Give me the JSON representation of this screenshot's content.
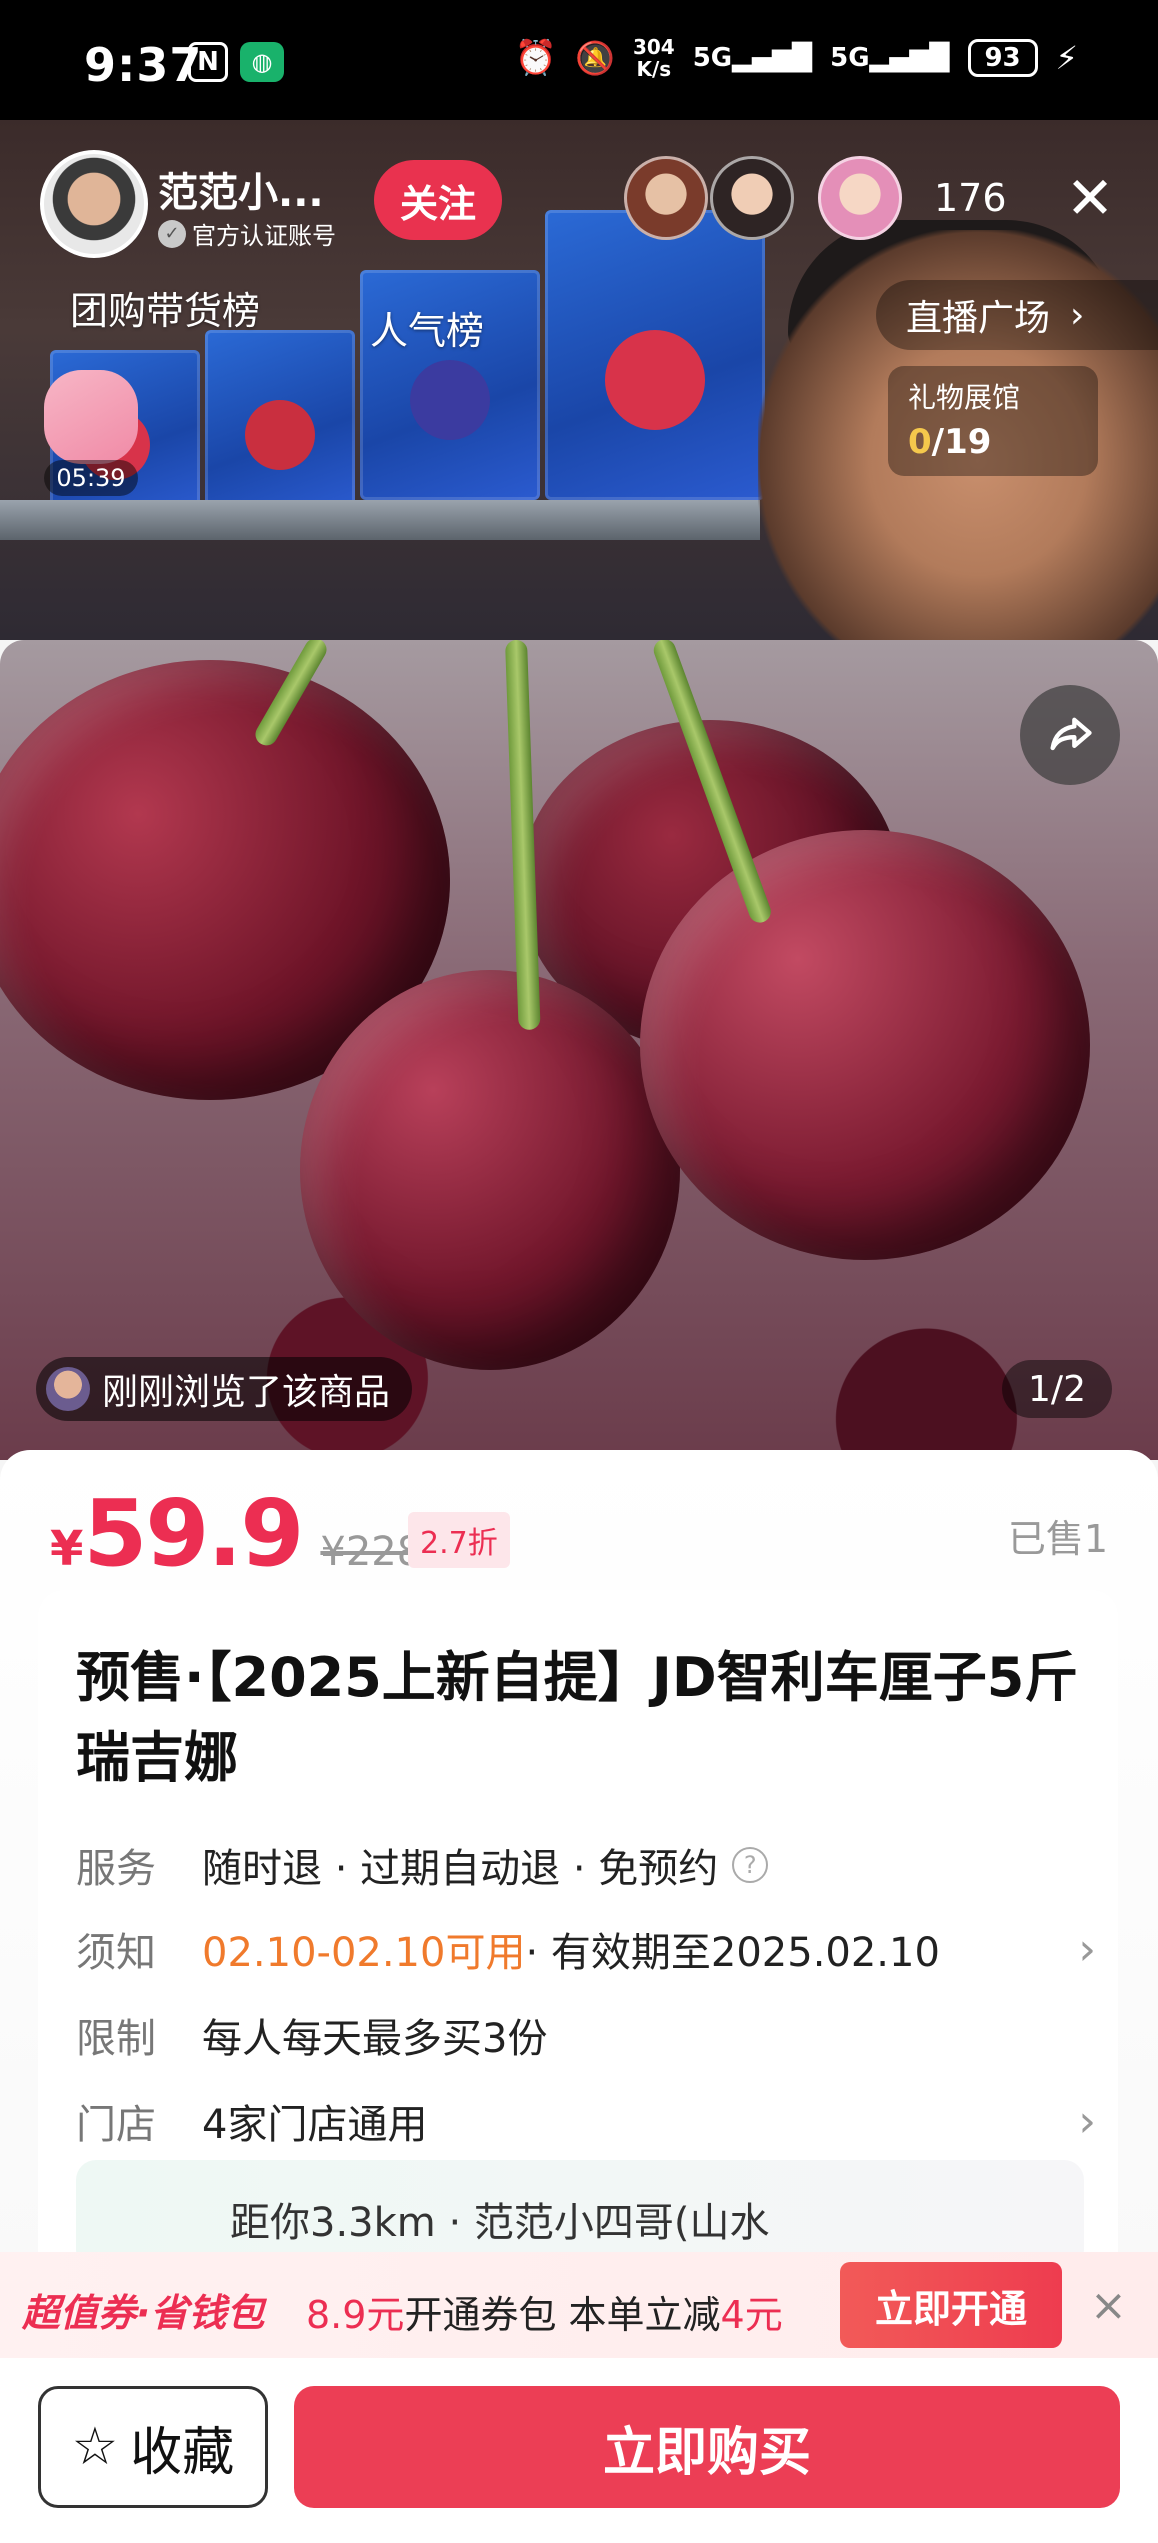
{
  "status_bar": {
    "time": "9:37",
    "nfc_icon": "N",
    "net_speed_value": "304",
    "net_speed_unit": "K/s",
    "sig1": "5G",
    "sig2": "5G",
    "battery": "93"
  },
  "live": {
    "streamer_name": "范范小...",
    "verified_label": "官方认证账号",
    "follow_label": "关注",
    "viewer_count": "176",
    "rank_group": "团购带货榜",
    "rank_popular": "人气榜",
    "plaza_label": "直播广场",
    "gift_title": "礼物展馆",
    "gift_current": "0",
    "gift_total": "/19",
    "timer": "05:39"
  },
  "gallery": {
    "recent_viewed": "刚刚浏览了该商品",
    "page_indicator": "1/2"
  },
  "product": {
    "currency": "¥",
    "price": "59.9",
    "original_price": "¥228",
    "discount": "2.7折",
    "sold": "已售1",
    "title": "预售·【2025上新自提】JD智利车厘子5斤瑞吉娜",
    "service_key": "服务",
    "service_value": "随时退 · 过期自动退 · 免预约",
    "notice_key": "须知",
    "notice_highlight": "02.10-02.10可用",
    "notice_rest": " · 有效期至2025.02.10",
    "limit_key": "限制",
    "limit_value": "每人每天最多买3份",
    "store_key": "门店",
    "store_value": "4家门店通用",
    "store_peek": "距你3.3km · 范范小四哥(山水"
  },
  "coupon": {
    "brand": "超值券·省钱包",
    "price": "8.9元",
    "text_mid": "开通券包 本单立减",
    "save": "4元",
    "button": "立即开通",
    "close": "×"
  },
  "bottom": {
    "favorite": "收藏",
    "buy": "立即购买"
  },
  "colors": {
    "accent": "#ec2e52",
    "orange": "#f07a2c",
    "buy": "#ec3e55"
  }
}
